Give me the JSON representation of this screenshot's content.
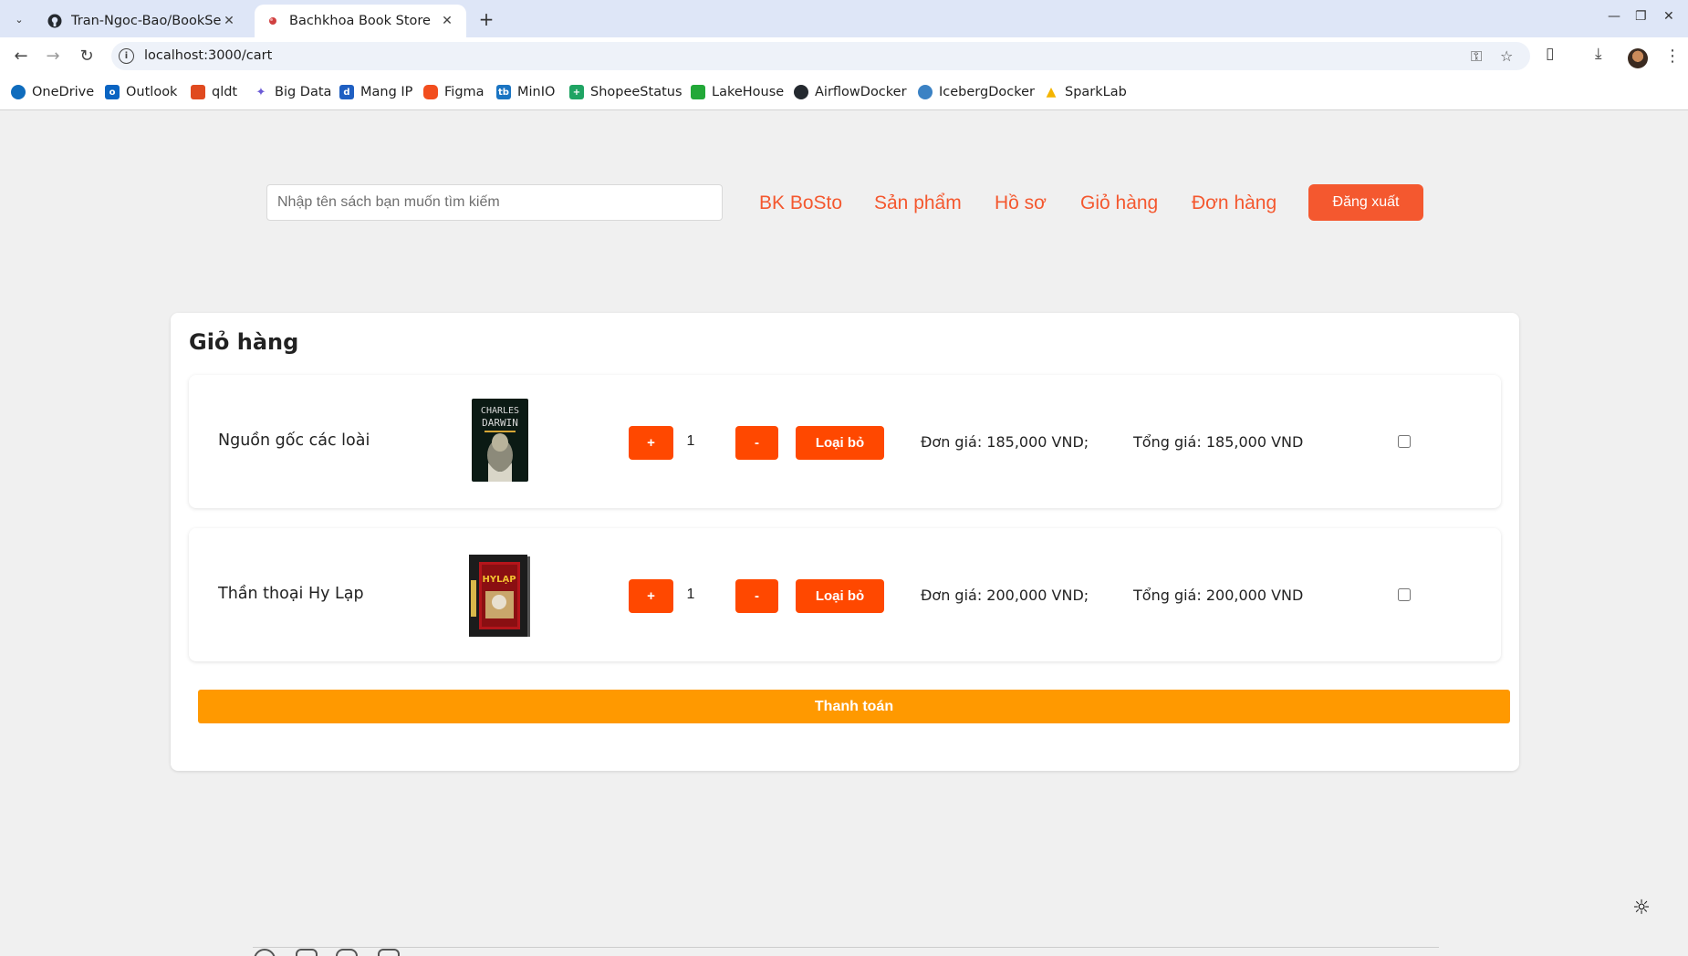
{
  "browser": {
    "tabs": [
      {
        "title": "Tran-Ngoc-Bao/BookSell",
        "icon": "github-icon"
      },
      {
        "title": "Bachkhoa Book Store",
        "icon": "app-favicon"
      }
    ],
    "url": "localhost:3000/cart",
    "bookmarks": [
      {
        "label": "OneDrive",
        "icon": "onedrive-icon",
        "color": "#0f6cbd"
      },
      {
        "label": "Outlook",
        "icon": "outlook-icon",
        "color": "#0a64c2"
      },
      {
        "label": "qldt",
        "icon": "qldt-icon",
        "color": "#e04a1f"
      },
      {
        "label": "Big Data",
        "icon": "bigdata-icon",
        "color": "#6b5bd6"
      },
      {
        "label": "Mang IP",
        "icon": "mangip-icon",
        "color": "#1f5fc2"
      },
      {
        "label": "Figma",
        "icon": "figma-icon",
        "color": "#f24e1e"
      },
      {
        "label": "MinIO",
        "icon": "minio-icon",
        "color": "#1a74c2"
      },
      {
        "label": "ShopeeStatus",
        "icon": "sheets-icon",
        "color": "#1fa463"
      },
      {
        "label": "LakeHouse",
        "icon": "lakehouse-icon",
        "color": "#22a838"
      },
      {
        "label": "AirflowDocker",
        "icon": "github-icon",
        "color": "#24292f"
      },
      {
        "label": "IcebergDocker",
        "icon": "globe-icon",
        "color": "#3b82c4"
      },
      {
        "label": "SparkLab",
        "icon": "drive-icon",
        "color": "#f4b400"
      }
    ]
  },
  "header": {
    "search_placeholder": "Nhập tên sách bạn muốn tìm kiếm",
    "nav": [
      "BK BoSto",
      "Sản phẩm",
      "Hồ sơ",
      "Giỏ hàng",
      "Đơn hàng"
    ],
    "logout_label": "Đăng xuất"
  },
  "cart": {
    "title": "Giỏ hàng",
    "plus_label": "+",
    "minus_label": "-",
    "remove_label": "Loại bỏ",
    "items": [
      {
        "name": "Nguồn gốc các loài",
        "quantity": "1",
        "unit_price": "Đơn giá: 185,000 VND;",
        "total_price": "Tổng giá: 185,000 VND",
        "cover_text": [
          "CHARLES",
          "DARWIN"
        ],
        "cover_color": "#0b1a14"
      },
      {
        "name": "Thần thoại Hy Lạp",
        "quantity": "1",
        "unit_price": "Đơn giá: 200,000 VND;",
        "total_price": "Tổng giá: 200,000 VND",
        "cover_text": [
          "HYLẠP"
        ],
        "cover_color": "#1c1c1c"
      }
    ],
    "checkout_label": "Thanh toán"
  },
  "colors": {
    "accent": "#f4582f",
    "button_red": "#ff4800",
    "checkout_orange": "#ff9900"
  }
}
